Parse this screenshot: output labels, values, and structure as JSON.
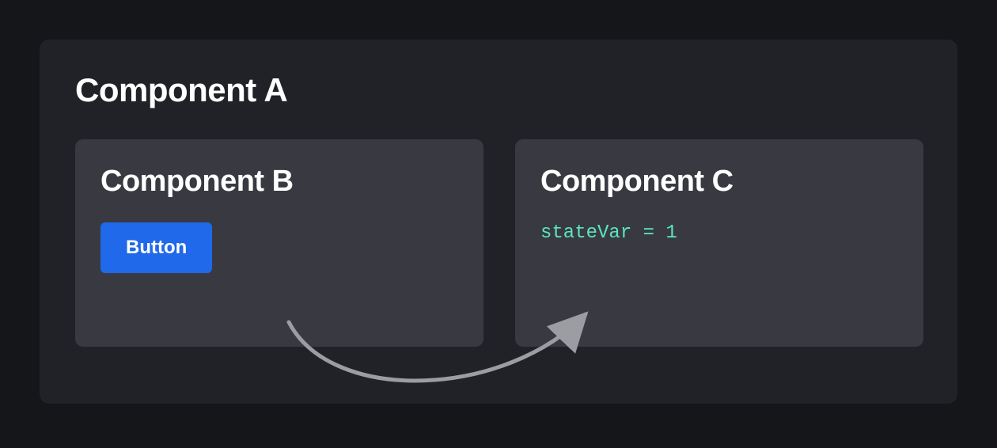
{
  "component_a": {
    "title": "Component A"
  },
  "component_b": {
    "title": "Component B",
    "button_label": "Button"
  },
  "component_c": {
    "title": "Component C",
    "code": "stateVar = 1"
  }
}
